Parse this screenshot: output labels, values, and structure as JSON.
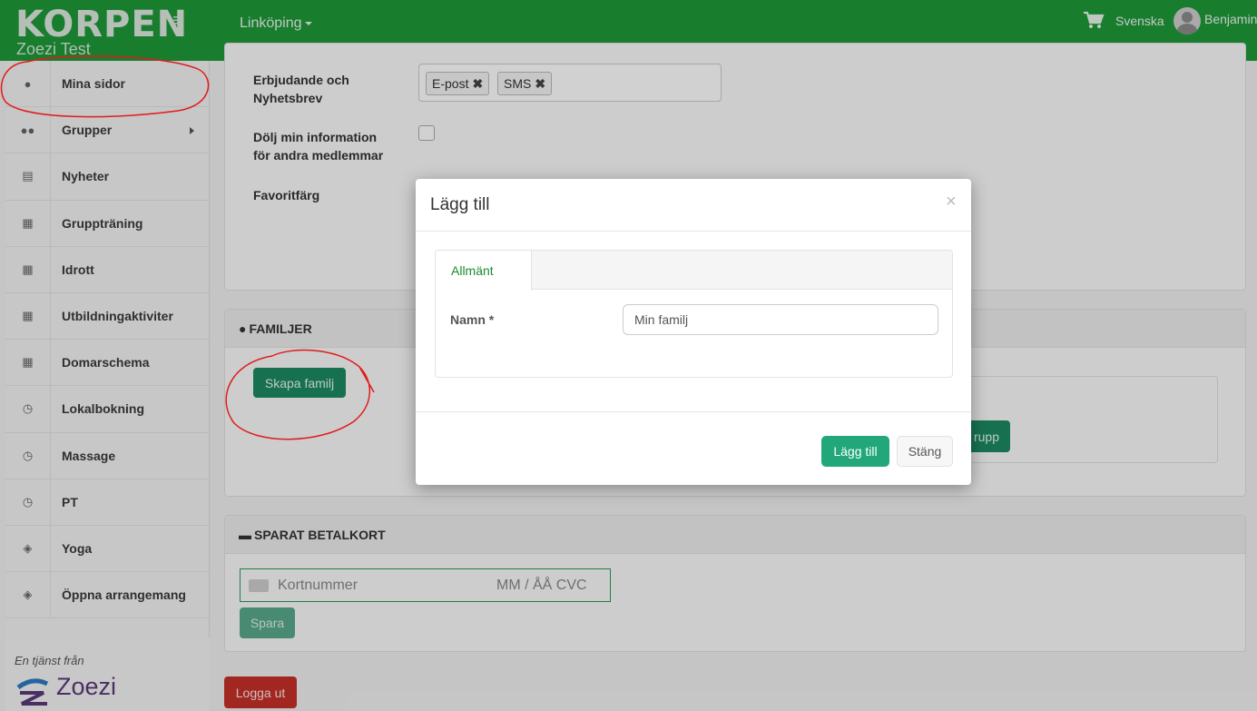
{
  "header": {
    "logo": "KORPEN",
    "sublogo": "Zoezi Test",
    "city": "Linköping",
    "language": "Svenska",
    "user": "Benjamin"
  },
  "sidebar": {
    "items": [
      {
        "label": "Mina sidor",
        "icon": "user-icon"
      },
      {
        "label": "Grupper",
        "icon": "users-icon"
      },
      {
        "label": "Nyheter",
        "icon": "newspaper-icon"
      },
      {
        "label": "Gruppträning",
        "icon": "calendar-icon"
      },
      {
        "label": "Idrott",
        "icon": "calendar-icon"
      },
      {
        "label": "Utbildningaktiviter",
        "icon": "calendar-icon"
      },
      {
        "label": "Domarschema",
        "icon": "calendar-icon"
      },
      {
        "label": "Lokalbokning",
        "icon": "clock-icon"
      },
      {
        "label": "Massage",
        "icon": "clock-icon"
      },
      {
        "label": "PT",
        "icon": "clock-icon"
      },
      {
        "label": "Yoga",
        "icon": "ticket-icon"
      },
      {
        "label": "Öppna arrangemang",
        "icon": "ticket-icon"
      }
    ],
    "footer_text": "En tjänst från",
    "footer_brand": "Zoezi"
  },
  "profile": {
    "offers_label": "Erbjudande och Nyhetsbrev",
    "tags": [
      "E-post",
      "SMS"
    ],
    "tag_remove": "✖",
    "hide_info_label": "Dölj min information för andra medlemmar",
    "fav_color_label": "Favoritfärg"
  },
  "families": {
    "heading": "FAMILJER",
    "create_button": "Skapa familj",
    "partial_button": "rupp"
  },
  "saved_card": {
    "heading": "SPARAT BETALKORT",
    "card_placeholder": "Kortnummer",
    "expiry_placeholder": "MM / ÅÅ  CVC",
    "save_button": "Spara"
  },
  "logout_button": "Logga ut",
  "modal": {
    "title": "Lägg till",
    "close": "×",
    "tab": "Allmänt",
    "name_label": "Namn *",
    "name_value": "Min familj",
    "add_button": "Lägg till",
    "cancel_button": "Stäng"
  },
  "colors": {
    "header_green": "#1f9939",
    "primary_button": "#22a77a",
    "danger_button": "#c63029",
    "annotation_red": "#e11b1b"
  }
}
